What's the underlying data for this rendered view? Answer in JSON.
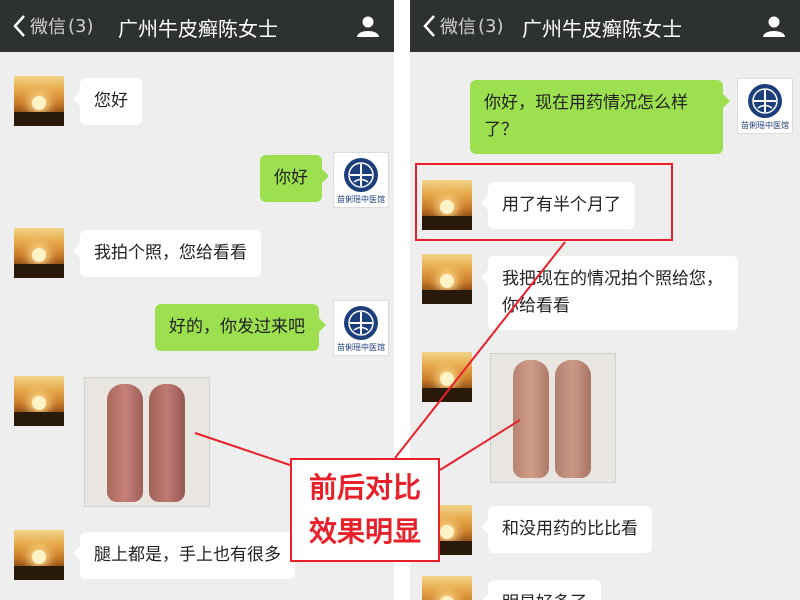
{
  "left": {
    "back_label": "微信",
    "unread_count": "(3)",
    "title": "广州牛皮癣陈女士",
    "messages": [
      {
        "side": "received",
        "text": "您好"
      },
      {
        "side": "sent",
        "text": "你好"
      },
      {
        "side": "received",
        "text": "我拍个照，您给看看"
      },
      {
        "side": "sent",
        "text": "好的，你发过来吧"
      },
      {
        "side": "received",
        "type": "photo",
        "subject": "legs-before"
      },
      {
        "side": "received",
        "text": "腿上都是，手上也有很多"
      }
    ]
  },
  "right": {
    "back_label": "微信",
    "unread_count": "(3)",
    "title": "广州牛皮癣陈女士",
    "messages": [
      {
        "side": "sent",
        "text": "你好，现在用药情况怎么样了？"
      },
      {
        "side": "received",
        "text": "用了有半个月了"
      },
      {
        "side": "received",
        "text": "我把现在的情况拍个照给您，你给看看"
      },
      {
        "side": "received",
        "type": "photo",
        "subject": "legs-after"
      },
      {
        "side": "received",
        "text": "和没用药的比比看"
      },
      {
        "side": "received",
        "text": "明显好多了"
      }
    ]
  },
  "clinic_logo_text": "苗俐瑶中医馆",
  "annotation": {
    "line1": "前后对比",
    "line2": "效果明显"
  },
  "icons": {
    "back": "chevron-left-icon",
    "profile": "person-icon"
  },
  "colors": {
    "topbar": "#2e3132",
    "chat_bg": "#eeeeee",
    "sent_bubble": "#9ce050",
    "received_bubble": "#ffffff",
    "annotation_red": "#e8202a",
    "logo_blue": "#1c3f7c"
  }
}
